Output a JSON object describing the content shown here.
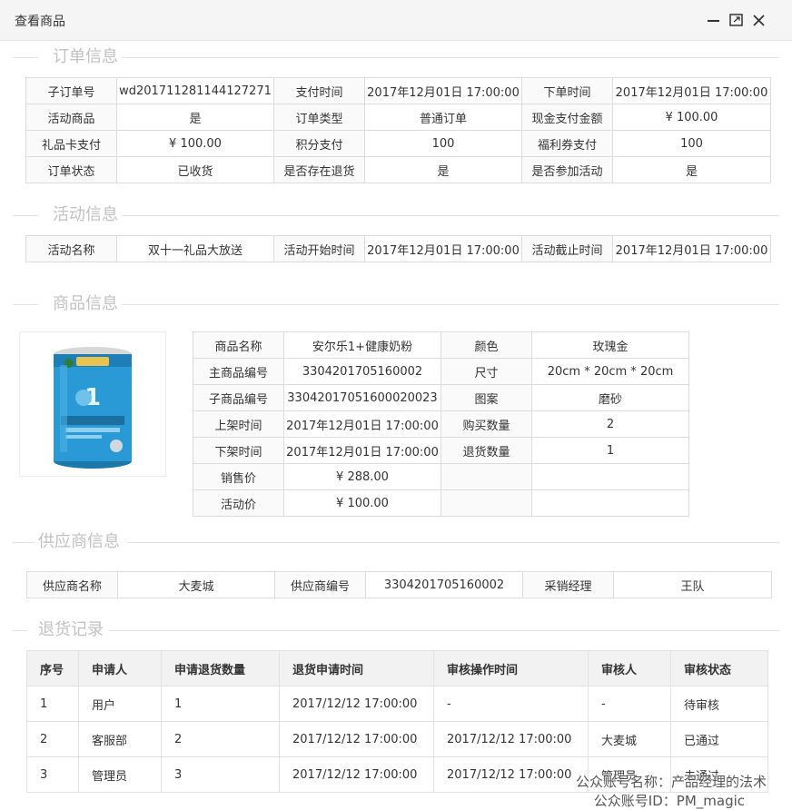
{
  "window": {
    "title": "查看商品",
    "controls": [
      "minimize-icon",
      "maximize-icon",
      "close-icon"
    ]
  },
  "sections": {
    "order": "订单信息",
    "activity": "活动信息",
    "product": "商品信息",
    "supplier": "供应商信息",
    "returns": "退货记录"
  },
  "order": {
    "rows": [
      [
        "子订单号",
        "wd201711281144127271",
        "支付时间",
        "2017年12月01日 17:00:00",
        "下单时间",
        "2017年12月01日 17:00:00"
      ],
      [
        "活动商品",
        "是",
        "订单类型",
        "普通订单",
        "现金支付金额",
        "¥ 100.00"
      ],
      [
        "礼品卡支付",
        "¥ 100.00",
        "积分支付",
        "100",
        "福利券支付",
        "100"
      ],
      [
        "订单状态",
        "已收货",
        "是否存在退货",
        "是",
        "是否参加活动",
        "是"
      ]
    ]
  },
  "activity": {
    "rows": [
      [
        "活动名称",
        "双十一礼品大放送",
        "活动开始时间",
        "2017年12月01日 17:00:00",
        "活动截止时间",
        "2017年12月01日 17:00:00"
      ]
    ]
  },
  "product": {
    "image_alt": "婴儿配方奶粉",
    "rows": [
      [
        "商品名称",
        "安尔乐1+健康奶粉",
        "颜色",
        "玫瑰金"
      ],
      [
        "主商品编号",
        "3304201705160002",
        "尺寸",
        "20cm * 20cm * 20cm"
      ],
      [
        "子商品编号",
        "33042017051600020023",
        "图案",
        "磨砂"
      ],
      [
        "上架时间",
        "2017年12月01日 17:00:00",
        "购买数量",
        "2"
      ],
      [
        "下架时间",
        "2017年12月01日 17:00:00",
        "退货数量",
        "1"
      ],
      [
        "销售价",
        "¥ 288.00",
        "",
        ""
      ],
      [
        "活动价",
        "¥ 100.00",
        "",
        ""
      ]
    ]
  },
  "supplier": {
    "rows": [
      [
        "供应商名称",
        "大麦城",
        "供应商编号",
        "3304201705160002",
        "采销经理",
        "王队"
      ]
    ]
  },
  "returns": {
    "headers": [
      "序号",
      "申请人",
      "申请退货数量",
      "退货申请时间",
      "审核操作时间",
      "审核人",
      "审核状态"
    ],
    "rows": [
      [
        "1",
        "用户",
        "1",
        "2017/12/12 17:00:00",
        "-",
        "-",
        "待审核"
      ],
      [
        "2",
        "客服部",
        "2",
        "2017/12/12 17:00:00",
        "2017/12/12 17:00:00",
        "大麦城",
        "已通过"
      ],
      [
        "3",
        "管理员",
        "3",
        "2017/12/12 17:00:00",
        "2017/12/12 17:00:00",
        "管理员",
        "未通过"
      ]
    ]
  },
  "watermark": {
    "line1": "公众账号名称：产品经理的法术",
    "line2": "公众账号ID：PM_magic"
  },
  "colors": {
    "titlebar_bg": "#f5f5f5",
    "key_cell_bg": "#fafafa",
    "header_bg": "#f2f2f2",
    "section_title": "#c2c2c2",
    "border": "#dcdcdc",
    "can_blue": "#2a9ad6"
  }
}
